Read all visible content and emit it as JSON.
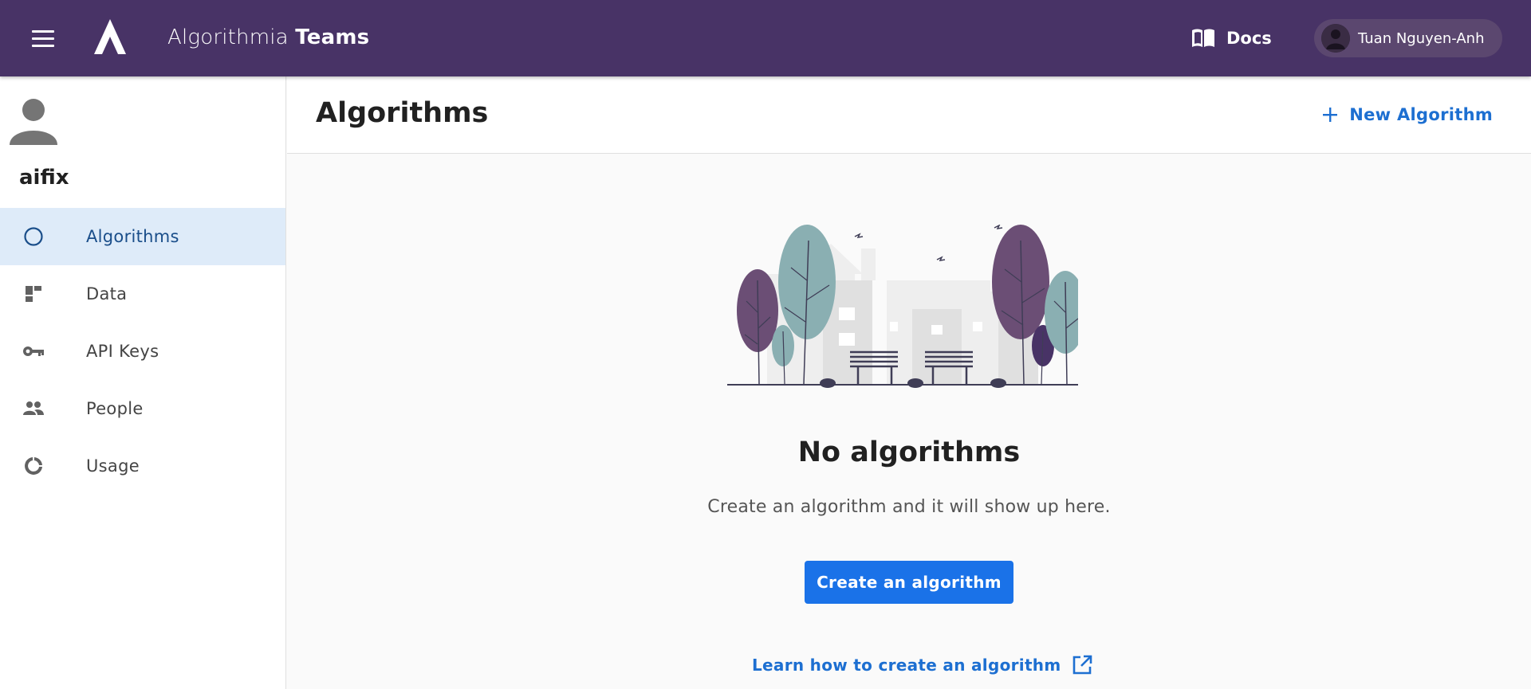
{
  "topbar": {
    "brand_light": "Algorithmia",
    "brand_bold": "Teams",
    "docs_label": "Docs",
    "user_name": "Tuan Nguyen-Anh",
    "icons": {
      "menu": "hamburger-icon",
      "logo": "algorithmia-logo",
      "docs": "book-icon"
    }
  },
  "sidebar": {
    "org_name": "aifix",
    "items": [
      {
        "label": "Algorithms",
        "icon": "circle-icon",
        "active": true
      },
      {
        "label": "Data",
        "icon": "dashboard-icon",
        "active": false
      },
      {
        "label": "API Keys",
        "icon": "key-icon",
        "active": false
      },
      {
        "label": "People",
        "icon": "people-icon",
        "active": false
      },
      {
        "label": "Usage",
        "icon": "donut-icon",
        "active": false
      }
    ]
  },
  "main": {
    "title": "Algorithms",
    "new_button": "New Algorithm",
    "empty": {
      "title": "No algorithms",
      "subtitle": "Create an algorithm and it will show up here.",
      "create_button": "Create an algorithm",
      "learn_link": "Learn how to create an algorithm"
    }
  },
  "colors": {
    "topbar": "#483366",
    "accent": "#1a72e8",
    "active_nav_bg": "#deebf9"
  }
}
